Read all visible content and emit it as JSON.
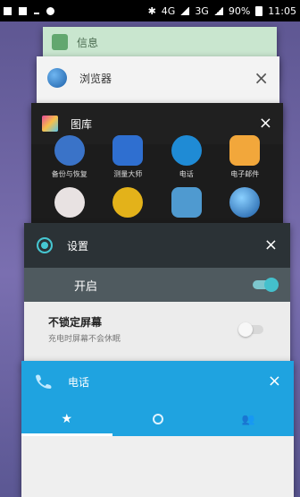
{
  "status_bar": {
    "network_4g": "4G",
    "network_3g": "3G",
    "battery_percent": "90%",
    "time": "11:05"
  },
  "recents": {
    "card0": {
      "title": "信息"
    },
    "browser": {
      "title": "浏览器",
      "close": "×"
    },
    "gallery": {
      "title": "图库",
      "close": "×",
      "apps": [
        {
          "label": "备份与恢复"
        },
        {
          "label": "测量大师"
        },
        {
          "label": "电话"
        },
        {
          "label": "电子邮件"
        },
        {
          "label": ""
        },
        {
          "label": ""
        },
        {
          "label": ""
        },
        {
          "label": ""
        }
      ]
    },
    "settings": {
      "title": "设置",
      "close": "×",
      "toggle_label": "开启",
      "toggle_on": true,
      "item_title": "不锁定屏幕",
      "item_subtitle": "充电时屏幕不会休眠",
      "item_toggle_on": false
    },
    "phone": {
      "title": "电话",
      "close": "×",
      "tabs": [
        {
          "icon": "star-icon",
          "glyph": "★"
        },
        {
          "icon": "clock-icon",
          "glyph": ""
        },
        {
          "icon": "contacts-icon",
          "glyph": "👥"
        }
      ]
    }
  },
  "colors": {
    "phone_accent": "#1fa3e0",
    "settings_header": "#2b3236",
    "settings_toggle_row": "#4f5a5f",
    "toggle_on": "#44c0cc"
  }
}
